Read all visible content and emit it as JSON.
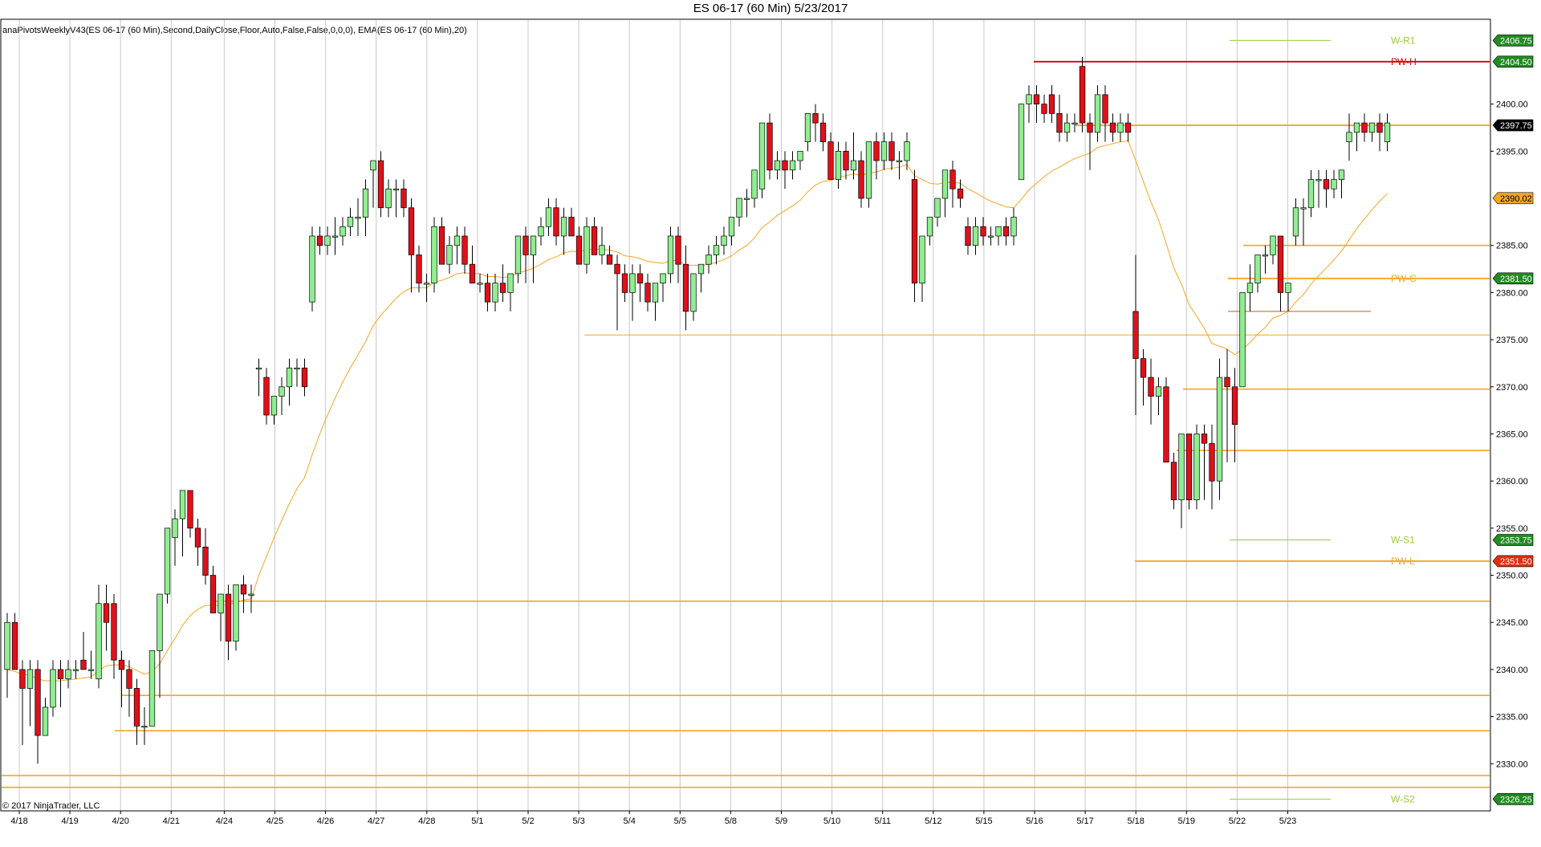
{
  "title": "ES 06-17 (60 Min)  5/23/2017",
  "indicator_label": "anaPivotsWeeklyV43(ES 06-17 (60 Min),Second,DailyClose,Floor,Auto,False,False,0,0,0), EMA(ES 06-17 (60 Min),20)",
  "copyright": "© 2017 NinjaTrader, LLC",
  "colors": {
    "up_candle": "#90ee90",
    "down_candle": "#e0101a",
    "wick": "#000000",
    "ema": "#f5a623",
    "level_orange": "#f5a623",
    "level_red": "#d90000",
    "level_green": "#9acd32",
    "grid": "#c8c8c8",
    "tag_green": "#228b22",
    "tag_orange": "#f5a623",
    "tag_red": "#e03010",
    "tag_black": "#000000"
  },
  "chart_data": {
    "type": "candlestick",
    "title": "ES 06-17 (60 Min)  5/23/2017",
    "ylim": [
      2325,
      2409
    ],
    "y_ticks": [
      2330.0,
      2335.0,
      2340.0,
      2345.0,
      2350.0,
      2355.0,
      2360.0,
      2365.0,
      2370.0,
      2375.0,
      2380.0,
      2385.0,
      2395.0,
      2400.0
    ],
    "x_dates": [
      "4/18",
      "4/19",
      "4/20",
      "4/21",
      "4/24",
      "4/25",
      "4/26",
      "4/27",
      "4/28",
      "5/1",
      "5/2",
      "5/3",
      "5/4",
      "5/5",
      "5/8",
      "5/9",
      "5/10",
      "5/11",
      "5/12",
      "5/15",
      "5/16",
      "5/17",
      "5/18",
      "5/19",
      "5/22",
      "5/23"
    ],
    "candles": [
      [
        2340,
        2346,
        2337,
        2345
      ],
      [
        2345,
        2346,
        2340,
        2340
      ],
      [
        2340,
        2341,
        2332,
        2338
      ],
      [
        2338,
        2341,
        2334,
        2340
      ],
      [
        2340,
        2341,
        2330,
        2333
      ],
      [
        2333,
        2337,
        2333,
        2336
      ],
      [
        2336,
        2341,
        2335,
        2340
      ],
      [
        2340,
        2341,
        2336,
        2339
      ],
      [
        2339,
        2341,
        2338,
        2340
      ],
      [
        2340,
        2341,
        2339,
        2340
      ],
      [
        2341,
        2344,
        2340,
        2340
      ],
      [
        2340,
        2342,
        2339,
        2340
      ],
      [
        2339,
        2349,
        2338,
        2347
      ],
      [
        2347,
        2349,
        2342,
        2345
      ],
      [
        2347,
        2348,
        2339,
        2341
      ],
      [
        2341,
        2342,
        2336,
        2340
      ],
      [
        2340,
        2341,
        2335,
        2338
      ],
      [
        2338,
        2339,
        2332,
        2334
      ],
      [
        2334,
        2336,
        2332,
        2334
      ],
      [
        2334,
        2342,
        2336,
        2342
      ],
      [
        2342,
        2343,
        2337,
        2348
      ],
      [
        2348,
        2355,
        2347,
        2355
      ],
      [
        2354,
        2357,
        2351,
        2356
      ],
      [
        2356,
        2358,
        2352,
        2359
      ],
      [
        2359,
        2358,
        2354,
        2355
      ],
      [
        2355,
        2356,
        2351,
        2353
      ],
      [
        2353,
        2355,
        2349,
        2350
      ],
      [
        2350,
        2351,
        2346,
        2346
      ],
      [
        2346,
        2348,
        2343,
        2348
      ],
      [
        2348,
        2349,
        2341,
        2343
      ],
      [
        2343,
        2349,
        2342,
        2349
      ],
      [
        2349,
        2350,
        2346,
        2348
      ],
      [
        2348,
        2349,
        2346,
        2348
      ],
      [
        2372,
        2373,
        2369,
        2372
      ],
      [
        2371,
        2372,
        2366,
        2367
      ],
      [
        2367,
        2369,
        2366,
        2369
      ],
      [
        2369,
        2371,
        2367,
        2370
      ],
      [
        2370,
        2373,
        2368,
        2372
      ],
      [
        2372,
        2373,
        2370,
        2372
      ],
      [
        2372,
        2373,
        2369,
        2370
      ],
      [
        2379,
        2387,
        2378,
        2386
      ],
      [
        2386,
        2387,
        2384,
        2385
      ],
      [
        2385,
        2387,
        2384,
        2386
      ],
      [
        2386,
        2388,
        2384,
        2386
      ],
      [
        2386,
        2388,
        2385,
        2387
      ],
      [
        2387,
        2389,
        2386,
        2388
      ],
      [
        2388,
        2390,
        2386,
        2388
      ],
      [
        2388,
        2392,
        2386,
        2391
      ],
      [
        2393,
        2394,
        2389,
        2394
      ],
      [
        2394,
        2395,
        2388,
        2389
      ],
      [
        2389,
        2392,
        2388,
        2391
      ],
      [
        2391,
        2392,
        2388,
        2391
      ],
      [
        2391,
        2392,
        2388,
        2389
      ],
      [
        2389,
        2390,
        2380,
        2384
      ],
      [
        2384,
        2385,
        2380,
        2381
      ],
      [
        2381,
        2382,
        2379,
        2381
      ],
      [
        2381,
        2388,
        2380,
        2387
      ],
      [
        2387,
        2388,
        2383,
        2383
      ],
      [
        2383,
        2386,
        2382,
        2385
      ],
      [
        2385,
        2387,
        2383,
        2386
      ],
      [
        2386,
        2387,
        2382,
        2383
      ],
      [
        2383,
        2385,
        2381,
        2381
      ],
      [
        2381,
        2382,
        2380,
        2381
      ],
      [
        2381,
        2382,
        2378,
        2379
      ],
      [
        2379,
        2382,
        2378,
        2381
      ],
      [
        2381,
        2383,
        2379,
        2380
      ],
      [
        2380,
        2382,
        2378,
        2382
      ],
      [
        2382,
        2386,
        2381,
        2386
      ],
      [
        2386,
        2387,
        2381,
        2384
      ],
      [
        2384,
        2386,
        2381,
        2386
      ],
      [
        2386,
        2388,
        2385,
        2387
      ],
      [
        2387,
        2390,
        2386,
        2389
      ],
      [
        2389,
        2390,
        2385,
        2386
      ],
      [
        2386,
        2389,
        2384,
        2388
      ],
      [
        2388,
        2389,
        2386,
        2386
      ],
      [
        2386,
        2387,
        2383,
        2383
      ],
      [
        2383,
        2388,
        2382,
        2387
      ],
      [
        2387,
        2388,
        2384,
        2384
      ],
      [
        2384,
        2387,
        2383,
        2385
      ],
      [
        2384,
        2385,
        2383,
        2383
      ],
      [
        2383,
        2384,
        2376,
        2382
      ],
      [
        2382,
        2383,
        2379,
        2380
      ],
      [
        2380,
        2383,
        2377,
        2382
      ],
      [
        2382,
        2383,
        2379,
        2381
      ],
      [
        2381,
        2382,
        2378,
        2379
      ],
      [
        2379,
        2381,
        2377,
        2381
      ],
      [
        2381,
        2382,
        2379,
        2382
      ],
      [
        2382,
        2387,
        2381,
        2386
      ],
      [
        2386,
        2387,
        2381,
        2383
      ],
      [
        2383,
        2385,
        2376,
        2378
      ],
      [
        2378,
        2382,
        2377,
        2382
      ],
      [
        2382,
        2383,
        2380,
        2383
      ],
      [
        2383,
        2385,
        2382,
        2384
      ],
      [
        2384,
        2386,
        2383,
        2385
      ],
      [
        2385,
        2387,
        2384,
        2386
      ],
      [
        2386,
        2388,
        2385,
        2388
      ],
      [
        2388,
        2390,
        2387,
        2390
      ],
      [
        2390,
        2391,
        2388,
        2390
      ],
      [
        2390,
        2393,
        2389,
        2393
      ],
      [
        2391,
        2398,
        2390,
        2398
      ],
      [
        2398,
        2399,
        2392,
        2393
      ],
      [
        2393,
        2395,
        2392,
        2394
      ],
      [
        2394,
        2395,
        2391,
        2393
      ],
      [
        2393,
        2395,
        2392,
        2394
      ],
      [
        2394,
        2395,
        2393,
        2395
      ],
      [
        2396,
        2399,
        2395,
        2399
      ],
      [
        2399,
        2400,
        2396,
        2398
      ],
      [
        2398,
        2399,
        2395,
        2396
      ],
      [
        2396,
        2397,
        2392,
        2392
      ],
      [
        2392,
        2396,
        2391,
        2395
      ],
      [
        2395,
        2396,
        2392,
        2393
      ],
      [
        2393,
        2397,
        2392,
        2394
      ],
      [
        2394,
        2395,
        2389,
        2390
      ],
      [
        2390,
        2396,
        2389,
        2396
      ],
      [
        2396,
        2397,
        2392,
        2394
      ],
      [
        2394,
        2397,
        2393,
        2396
      ],
      [
        2396,
        2397,
        2393,
        2394
      ],
      [
        2394,
        2395,
        2392,
        2394
      ],
      [
        2394,
        2397,
        2393,
        2396
      ],
      [
        2392,
        2393,
        2379,
        2381
      ],
      [
        2381,
        2386,
        2379,
        2386
      ],
      [
        2386,
        2388,
        2385,
        2388
      ],
      [
        2388,
        2390,
        2387,
        2390
      ],
      [
        2390,
        2393,
        2388,
        2393
      ],
      [
        2393,
        2394,
        2389,
        2391
      ],
      [
        2391,
        2392,
        2389,
        2390
      ],
      [
        2387,
        2388,
        2384,
        2385
      ],
      [
        2385,
        2388,
        2384,
        2387
      ],
      [
        2387,
        2388,
        2385,
        2386
      ],
      [
        2386,
        2387,
        2385,
        2386
      ],
      [
        2386,
        2387,
        2385,
        2387
      ],
      [
        2387,
        2388,
        2385,
        2386
      ],
      [
        2386,
        2389,
        2385,
        2388
      ],
      [
        2392,
        2400,
        2392,
        2400
      ],
      [
        2400,
        2402,
        2398,
        2401
      ],
      [
        2401,
        2402,
        2398,
        2400
      ],
      [
        2400,
        2401,
        2398,
        2399
      ],
      [
        2401,
        2402,
        2398,
        2399
      ],
      [
        2399,
        2401,
        2396,
        2397
      ],
      [
        2397,
        2399,
        2396,
        2398
      ],
      [
        2398,
        2399,
        2397,
        2398
      ],
      [
        2404,
        2405,
        2397,
        2398
      ],
      [
        2398,
        2399,
        2393,
        2397
      ],
      [
        2397,
        2402,
        2396,
        2401
      ],
      [
        2401,
        2402,
        2396,
        2398
      ],
      [
        2398,
        2399,
        2396,
        2397
      ],
      [
        2397,
        2399,
        2396,
        2398
      ],
      [
        2398,
        2399,
        2396,
        2397
      ],
      [
        2378,
        2384,
        2367,
        2373
      ],
      [
        2373,
        2374,
        2368,
        2371
      ],
      [
        2371,
        2373,
        2366,
        2369
      ],
      [
        2369,
        2371,
        2367,
        2370
      ],
      [
        2370,
        2371,
        2362,
        2362
      ],
      [
        2362,
        2363,
        2357,
        2358
      ],
      [
        2358,
        2365,
        2355,
        2365
      ],
      [
        2365,
        2365,
        2357,
        2358
      ],
      [
        2358,
        2366,
        2357,
        2365
      ],
      [
        2365,
        2366,
        2358,
        2364
      ],
      [
        2364,
        2366,
        2357,
        2360
      ],
      [
        2360,
        2373,
        2358,
        2371
      ],
      [
        2371,
        2374,
        2362,
        2370
      ],
      [
        2370,
        2372,
        2362,
        2366
      ],
      [
        2370,
        2380,
        2370,
        2380
      ],
      [
        2380,
        2383,
        2378,
        2381
      ],
      [
        2381,
        2384,
        2380,
        2384
      ],
      [
        2384,
        2385,
        2382,
        2384
      ],
      [
        2384,
        2386,
        2383,
        2386
      ],
      [
        2386,
        2386,
        2378,
        2380
      ],
      [
        2380,
        2381,
        2378,
        2381
      ],
      [
        2386,
        2390,
        2385,
        2389
      ],
      [
        2389,
        2390,
        2385,
        2389
      ],
      [
        2389,
        2393,
        2388,
        2392
      ],
      [
        2392,
        2393,
        2389,
        2392
      ],
      [
        2392,
        2393,
        2389,
        2391
      ],
      [
        2391,
        2393,
        2390,
        2392
      ],
      [
        2392,
        2393,
        2390,
        2393
      ],
      [
        2396,
        2399,
        2394,
        2397
      ],
      [
        2397,
        2398,
        2395,
        2398
      ],
      [
        2398,
        2399,
        2396,
        2397
      ],
      [
        2397,
        2398,
        2396,
        2398
      ],
      [
        2398,
        2399,
        2395,
        2397
      ],
      [
        2396,
        2399,
        2395,
        2398
      ]
    ],
    "ema_20": [
      2340,
      2339.8,
      2339.5,
      2339.4,
      2339.0,
      2338.8,
      2338.8,
      2338.8,
      2338.9,
      2339.0,
      2339.1,
      2339.2,
      2339.9,
      2340.4,
      2340.5,
      2340.5,
      2340.3,
      2339.9,
      2339.5,
      2339.8,
      2340.6,
      2342.0,
      2343.3,
      2344.7,
      2345.7,
      2346.4,
      2346.8,
      2346.8,
      2346.8,
      2346.9,
      2347.1,
      2347.4,
      2347.5,
      2350.0,
      2352.0,
      2354.0,
      2355.8,
      2357.6,
      2359.2,
      2360.4,
      2362.8,
      2365.0,
      2367.0,
      2368.8,
      2370.5,
      2372.0,
      2373.4,
      2374.8,
      2376.5,
      2377.6,
      2378.5,
      2379.4,
      2380.1,
      2380.5,
      2380.5,
      2380.5,
      2381.1,
      2381.3,
      2381.6,
      2382.0,
      2382.1,
      2382.0,
      2382.0,
      2381.7,
      2381.7,
      2381.6,
      2381.7,
      2382.1,
      2382.3,
      2382.6,
      2383.0,
      2383.5,
      2383.8,
      2384.2,
      2384.4,
      2384.3,
      2384.6,
      2384.6,
      2384.6,
      2384.5,
      2384.3,
      2383.9,
      2383.8,
      2383.6,
      2383.3,
      2383.2,
      2383.1,
      2383.4,
      2383.4,
      2382.9,
      2382.9,
      2382.9,
      2383.0,
      2383.2,
      2383.5,
      2383.9,
      2384.5,
      2385.0,
      2385.8,
      2386.9,
      2387.5,
      2388.2,
      2388.7,
      2389.2,
      2389.8,
      2390.7,
      2391.4,
      2391.8,
      2391.9,
      2392.2,
      2392.4,
      2392.6,
      2392.4,
      2392.7,
      2392.8,
      2393.1,
      2393.2,
      2393.3,
      2393.6,
      2392.4,
      2392.0,
      2391.6,
      2391.5,
      2391.7,
      2391.7,
      2391.6,
      2391.0,
      2390.6,
      2390.1,
      2389.7,
      2389.4,
      2389.1,
      2389.0,
      2389.9,
      2390.9,
      2391.6,
      2392.3,
      2392.9,
      2393.3,
      2393.8,
      2394.2,
      2394.5,
      2394.8,
      2395.4,
      2395.6,
      2395.8,
      2396.0,
      2396.1,
      2394.0,
      2391.8,
      2389.6,
      2387.7,
      2385.2,
      2382.6,
      2380.9,
      2378.7,
      2377.5,
      2376.2,
      2374.6,
      2374.3,
      2374.0,
      2373.4,
      2374.0,
      2374.7,
      2375.6,
      2376.3,
      2377.3,
      2377.6,
      2378.0,
      2379.0,
      2379.8,
      2380.9,
      2381.8,
      2382.6,
      2383.5,
      2384.4,
      2385.6,
      2386.8,
      2387.8,
      2388.8,
      2389.7,
      2390.5
    ],
    "levels": [
      {
        "name": "W-R1",
        "value": 2406.75,
        "color": "#9acd32",
        "short": true,
        "label": "W-R1",
        "tag": "2406.75",
        "tag_bg": "#228b22"
      },
      {
        "name": "PW-H",
        "value": 2404.5,
        "color": "#d90000",
        "short": false,
        "label": "PW-H",
        "tag": "2404.50",
        "tag_bg": "#228b22"
      },
      {
        "name": "last",
        "value": 2397.75,
        "color": "#f5a623",
        "short": false,
        "label": "",
        "tag": "2397.75",
        "tag_bg": "#000000"
      },
      {
        "name": "ema-tag",
        "value": 2390.02,
        "color": "#f5a623",
        "short": false,
        "label": "",
        "tag": "2390.02",
        "tag_bg": "#f5a623",
        "no_line": true
      },
      {
        "name": "PW-C",
        "value": 2381.5,
        "color": "#f5a623",
        "short": false,
        "label": "PW-C",
        "tag": "2381.50",
        "tag_bg": "#228b22"
      },
      {
        "name": "W-S1",
        "value": 2353.75,
        "color": "#9acd32",
        "short": true,
        "label": "W-S1",
        "tag": "2353.75",
        "tag_bg": "#228b22"
      },
      {
        "name": "PW-L",
        "value": 2351.5,
        "color": "#f5a623",
        "short": false,
        "label": "PW-L",
        "tag": "2351.50",
        "tag_bg": "#e03010"
      },
      {
        "name": "W-S2",
        "value": 2326.25,
        "color": "#9acd32",
        "short": true,
        "label": "W-S2",
        "tag": "2326.25",
        "tag_bg": "#228b22"
      }
    ],
    "support_lines": [
      2385.0,
      2375.5,
      2369.75,
      2363.25,
      2347.25,
      2337.25,
      2333.5,
      2328.75,
      2327.5,
      2378.0
    ]
  }
}
